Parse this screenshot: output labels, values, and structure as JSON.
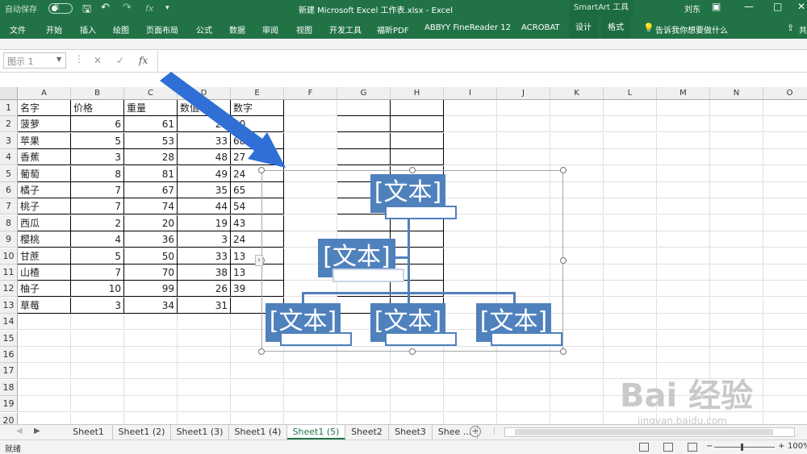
{
  "titlebar": {
    "autosave_label": "自动保存",
    "toggle_state": "关",
    "title": "新建 Microsoft Excel 工作表.xlsx  -  Excel",
    "context_group": "SmartArt 工具",
    "user": "刘东"
  },
  "ribbon": {
    "tabs": [
      "文件",
      "开始",
      "插入",
      "绘图",
      "页面布局",
      "公式",
      "数据",
      "审阅",
      "视图",
      "开发工具",
      "福昕PDF",
      "ABBYY FineReader 12",
      "ACROBAT"
    ],
    "context_tabs": [
      "设计",
      "格式"
    ],
    "tell_me": "告诉我你想要做什么",
    "share": "共"
  },
  "formula_bar": {
    "name_box": "图示 1",
    "fx": "fx"
  },
  "grid": {
    "columns": [
      "A",
      "B",
      "C",
      "D",
      "E",
      "F",
      "G",
      "H",
      "I",
      "J",
      "K",
      "L",
      "M",
      "N",
      "O"
    ],
    "rows": [
      "1",
      "2",
      "3",
      "4",
      "5",
      "6",
      "7",
      "8",
      "9",
      "10",
      "11",
      "12",
      "13",
      "14",
      "15",
      "16",
      "17",
      "18",
      "19",
      "20"
    ],
    "headers": [
      "名字",
      "价格",
      "重量",
      "数值",
      "数字"
    ],
    "data": [
      [
        "菠萝",
        "6",
        "61",
        "20",
        "10"
      ],
      [
        "苹果",
        "5",
        "53",
        "33",
        "68"
      ],
      [
        "香蕉",
        "3",
        "28",
        "48",
        "27"
      ],
      [
        "葡萄",
        "8",
        "81",
        "49",
        "24"
      ],
      [
        "橘子",
        "7",
        "67",
        "35",
        "65"
      ],
      [
        "桃子",
        "7",
        "74",
        "44",
        "54"
      ],
      [
        "西瓜",
        "2",
        "20",
        "19",
        "43"
      ],
      [
        "樱桃",
        "4",
        "36",
        "3",
        "24"
      ],
      [
        "甘蔗",
        "5",
        "50",
        "33",
        "13"
      ],
      [
        "山楂",
        "7",
        "70",
        "38",
        "13"
      ],
      [
        "柚子",
        "10",
        "99",
        "26",
        "39"
      ],
      [
        "草莓",
        "3",
        "34",
        "31",
        ""
      ]
    ]
  },
  "smartart": {
    "node_text": "[文本]"
  },
  "sheets": {
    "tabs": [
      "Sheet1",
      "Sheet1 (2)",
      "Sheet1 (3)",
      "Sheet1 (4)",
      "Sheet1 (5)",
      "Sheet2",
      "Sheet3",
      "Shee ..."
    ],
    "active_index": 4
  },
  "status": {
    "ready": "就绪",
    "zoom": "100%"
  },
  "watermark": {
    "main": "Bai 经验",
    "sub": "jingyan.baidu.com"
  },
  "colors": {
    "excel_green": "#217346",
    "smartart_blue": "#4f81bd",
    "annotation_arrow": "#2f6fd6"
  }
}
